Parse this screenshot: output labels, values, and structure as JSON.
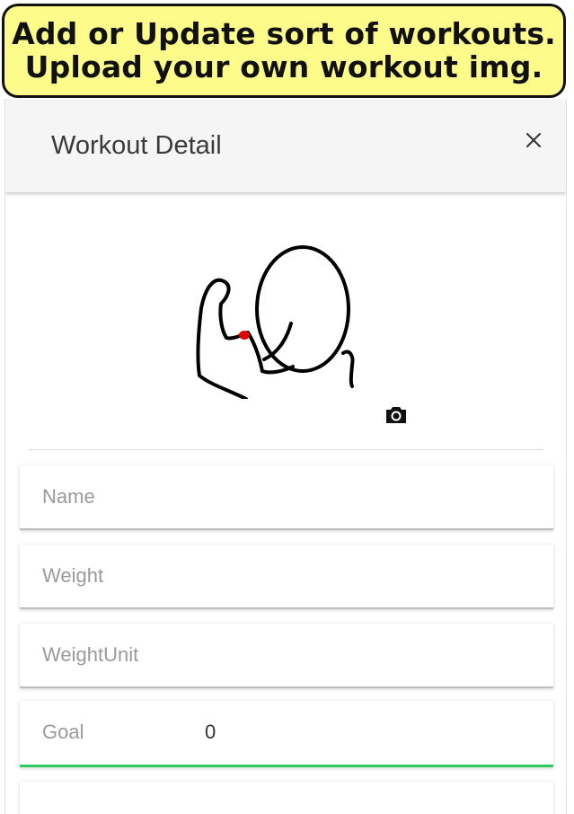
{
  "banner": {
    "line1": "Add or Update sort of workouts.",
    "line2": "Upload your own workout img."
  },
  "header": {
    "title": "Workout Detail",
    "close_icon": "close-icon"
  },
  "image": {
    "icon": "camera-icon"
  },
  "form": {
    "name": {
      "placeholder": "Name",
      "value": ""
    },
    "weight": {
      "placeholder": "Weight",
      "value": ""
    },
    "weight_unit": {
      "placeholder": "WeightUnit",
      "value": ""
    },
    "goal": {
      "placeholder": "Goal",
      "value": "0"
    }
  },
  "colors": {
    "banner_bg": "#fdfb8a",
    "active_underline": "#2ecc61",
    "muscle_red": "#e00000"
  }
}
